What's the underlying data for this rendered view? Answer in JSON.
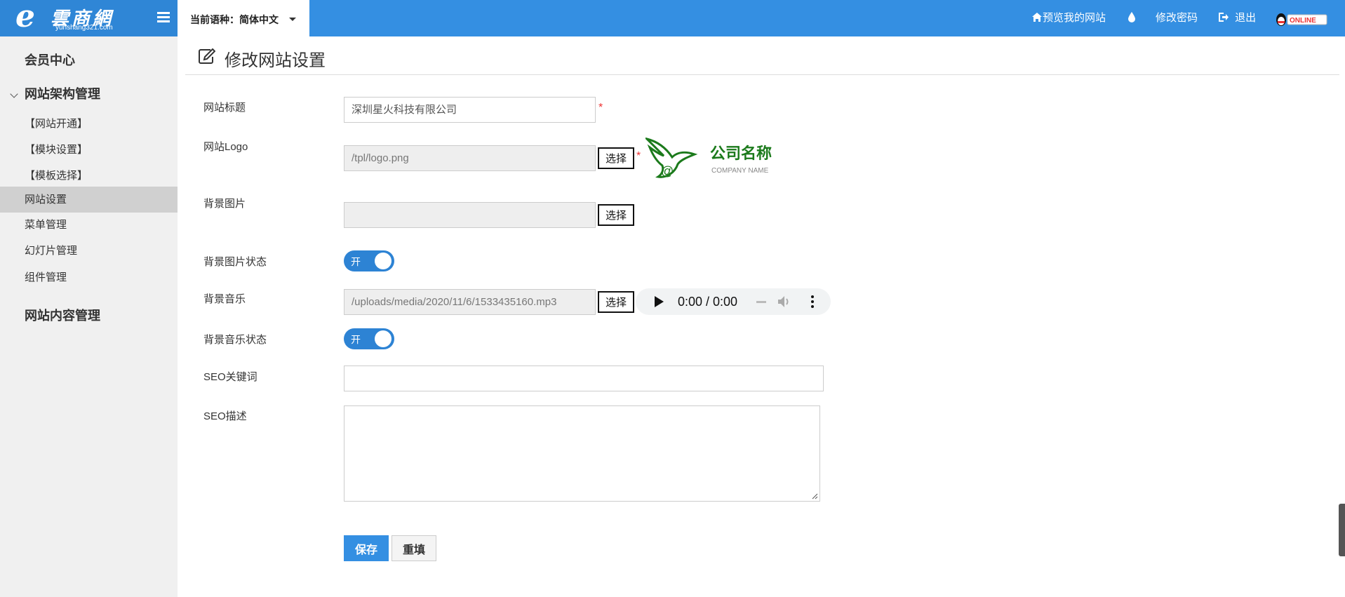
{
  "header": {
    "logo_text": "e雲商網",
    "logo_sub": "yunshang321.com",
    "language_label": "当前语种：简体中文",
    "nav": {
      "preview_site": "预览我的网站",
      "change_password": "修改密码",
      "logout": "退出",
      "online_badge": "ONLINE"
    }
  },
  "sidebar": {
    "member_center": "会员中心",
    "site_structure": "网站架构管理",
    "items": [
      {
        "label": "【网站开通】"
      },
      {
        "label": "【模块设置】"
      },
      {
        "label": "【模板选择】"
      },
      {
        "label": "网站设置"
      },
      {
        "label": "菜单管理"
      },
      {
        "label": "幻灯片管理"
      },
      {
        "label": "组件管理"
      }
    ],
    "site_content": "网站内容管理"
  },
  "page": {
    "title": "修改网站设置"
  },
  "form": {
    "site_title": {
      "label": "网站标题",
      "value": "深圳星火科技有限公司"
    },
    "site_logo": {
      "label": "网站Logo",
      "value": "/tpl/logo.png",
      "button": "选择"
    },
    "logo_preview": {
      "name": "公司名称",
      "sub": "COMPANY NAME"
    },
    "bg_image": {
      "label": "背景图片",
      "value": "",
      "button": "选择"
    },
    "bg_image_status": {
      "label": "背景图片状态",
      "toggle": "开"
    },
    "bg_music": {
      "label": "背景音乐",
      "value": "/uploads/media/2020/11/6/1533435160.mp3",
      "button": "选择",
      "player_time": "0:00 / 0:00"
    },
    "bg_music_status": {
      "label": "背景音乐状态",
      "toggle": "开"
    },
    "seo_keywords": {
      "label": "SEO关键词",
      "value": ""
    },
    "seo_description": {
      "label": "SEO描述",
      "value": ""
    },
    "required_mark": "*",
    "save": "保存",
    "reset": "重填"
  },
  "colors": {
    "accent": "#348fe2",
    "sidebar_bg": "#f0f0f0",
    "logo_green": "#1b7a1b"
  }
}
